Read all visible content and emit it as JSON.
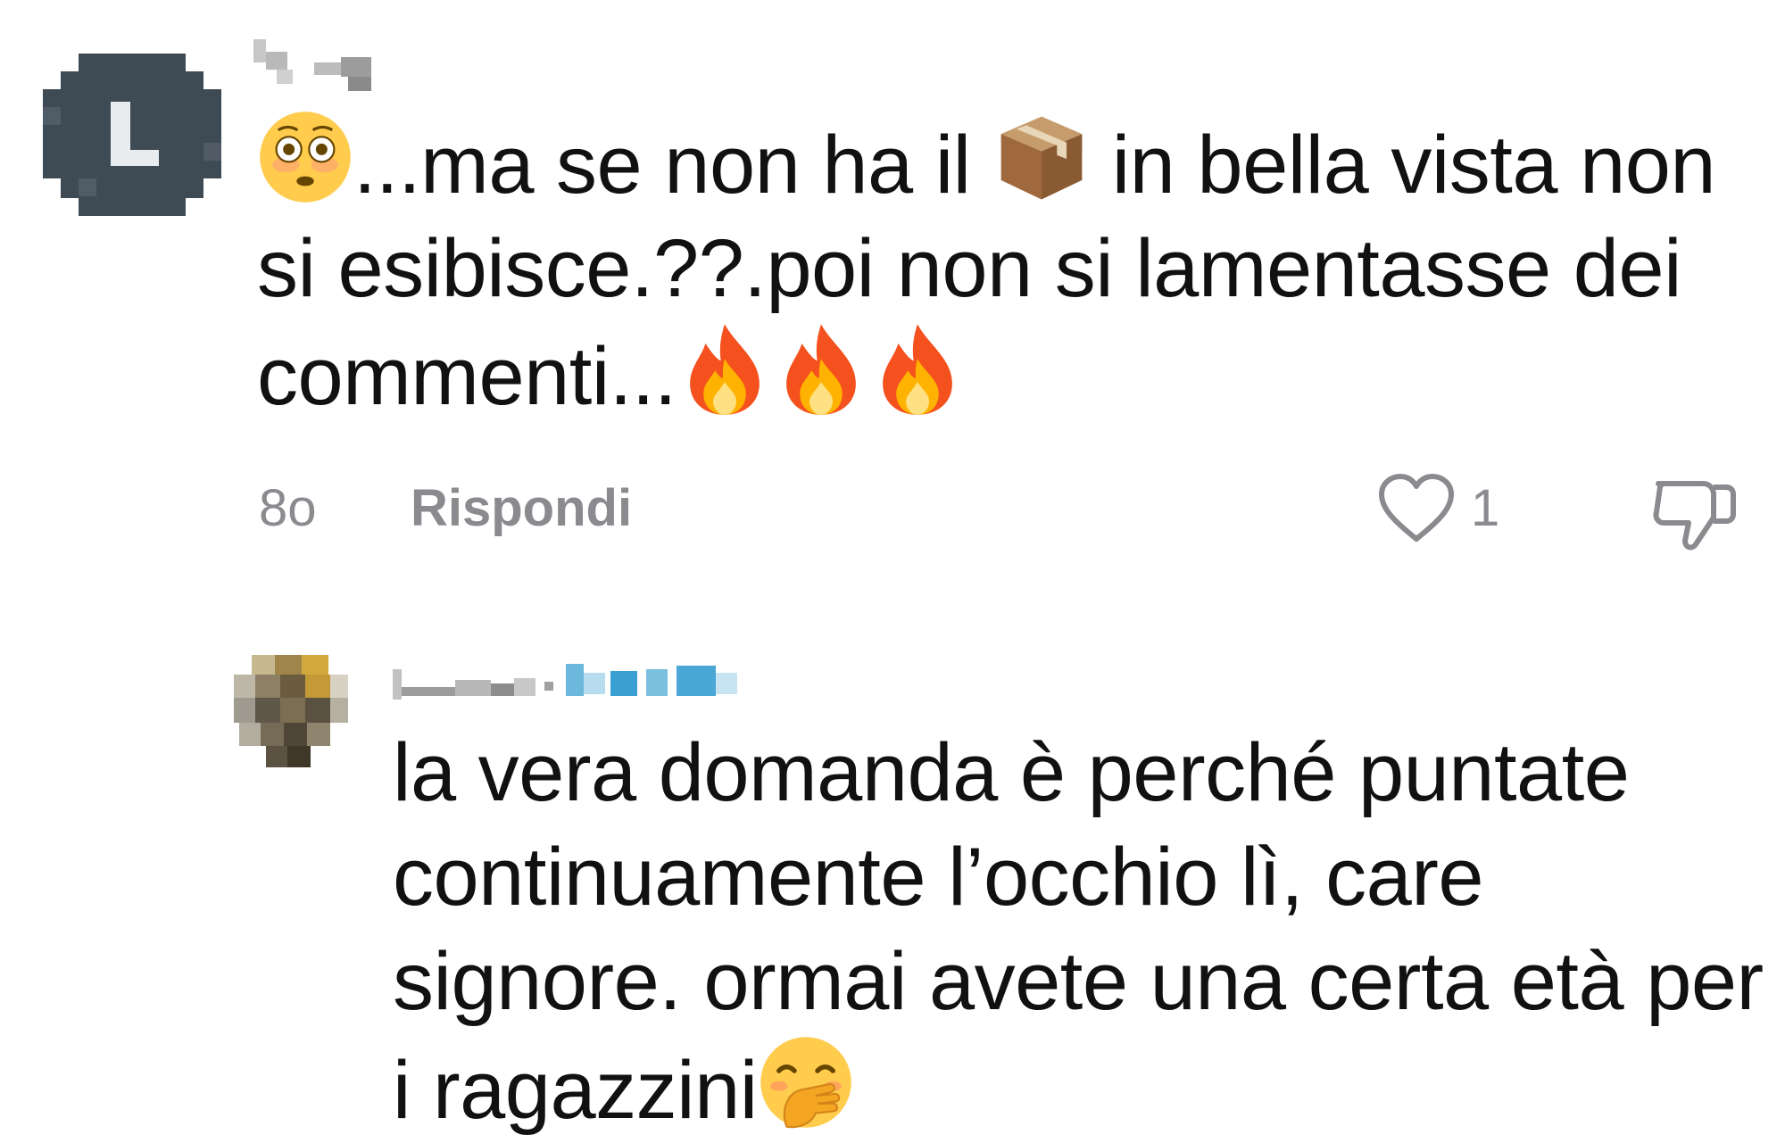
{
  "comments": [
    {
      "avatar_letter": "L",
      "text_part1": "...ma se non ha il ",
      "text_part2": " in bella vista non si esibisce.??.poi non si lamentasse dei commenti...",
      "emojis": [
        "flushed-face",
        "package",
        "fire",
        "fire",
        "fire"
      ],
      "time": "8o",
      "reply_label": "Rispondi",
      "like_count": "1"
    },
    {
      "text": "la vera domanda è perché puntate continuamente l’occhio lì, care signore. ormai avete una certa età per i ragazzini",
      "emojis": [
        "face-with-hand-over-mouth"
      ]
    }
  ],
  "colors": {
    "text": "#111111",
    "meta": "#8a8a8f",
    "avatar_bg": "#3e4a54",
    "blurred_link": "#39a6d8"
  }
}
